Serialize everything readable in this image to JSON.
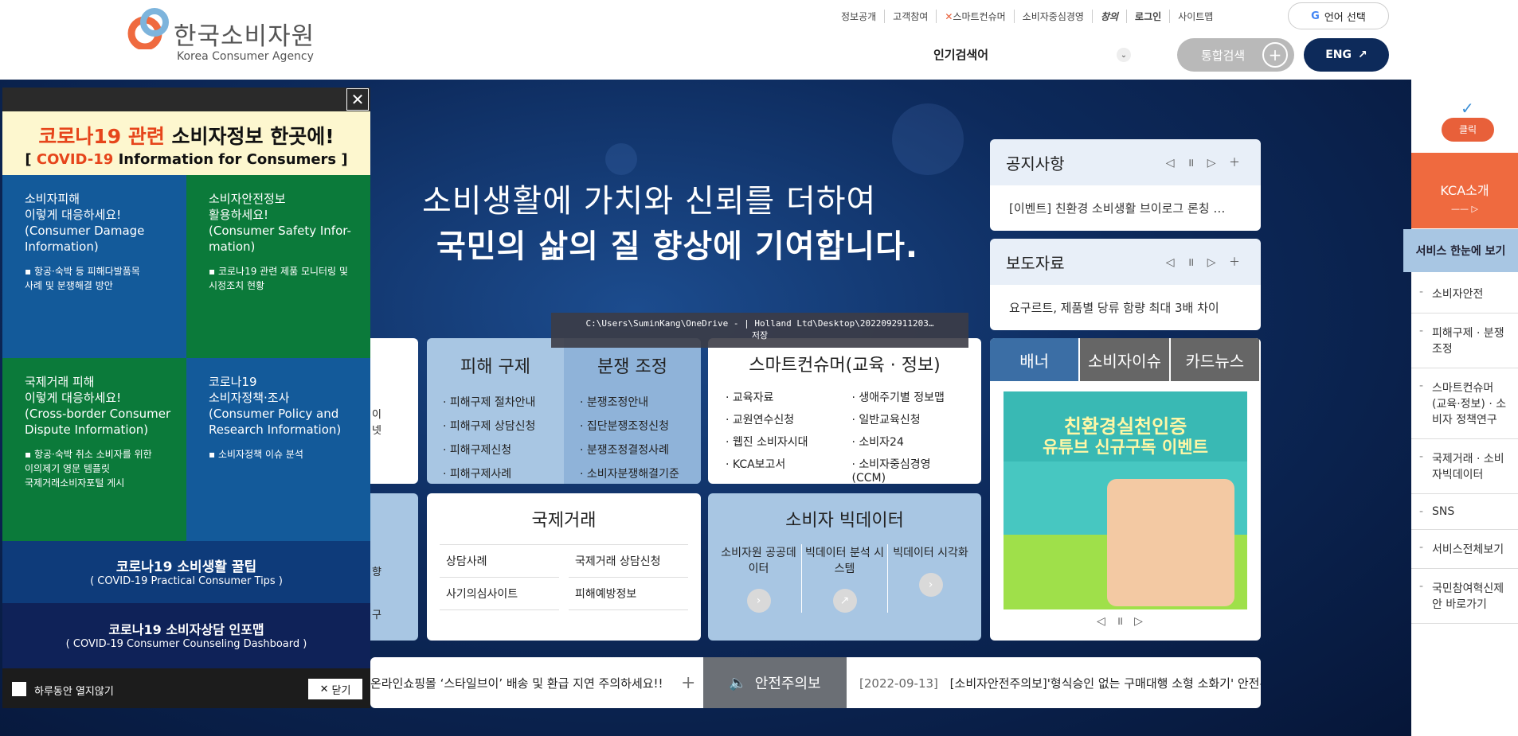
{
  "header": {
    "logo_ko": "한국소비자원",
    "logo_en": "Korea Consumer Agency",
    "util_links": [
      "정보공개",
      "고객참여",
      "스마트컨슈머",
      "소비자중심경영",
      "창의",
      "로그인",
      "사이트맵"
    ],
    "language_label": "언어 선택",
    "popular_label": "인기검색어",
    "search_label": "통합검색",
    "eng_label": "ENG"
  },
  "hero": {
    "line1": "소비생활에 가치와 신뢰를 더하여",
    "line2": "국민의 삶의 질 향상에 기여합니다.",
    "tooltip": "C:\\Users\\SuminKang\\OneDrive - | Holland Ltd\\Desktop\\2022092911203…\n저장"
  },
  "notice": {
    "title": "공지사항",
    "text": "[이벤트] 친환경 소비생활 브이로그 론칭 …"
  },
  "press": {
    "title": "보도자료",
    "text": "요구르트, 제품별 당류 함량 최대 3배 차이"
  },
  "banner_tabs": [
    "배너",
    "소비자이슈",
    "카드뉴스"
  ],
  "banner": {
    "title1": "친환경실천인증",
    "title2": "유튜브 신규구독 이벤트"
  },
  "relief": {
    "title1": "피해 구제",
    "items1": [
      "피해구제 절차안내",
      "피해구제 상담신청",
      "피해구제신청",
      "피해구제사례"
    ],
    "title2": "분쟁 조정",
    "items2": [
      "분쟁조정안내",
      "집단분쟁조정신청",
      "분쟁조정결정사례",
      "소비자분쟁해결기준"
    ]
  },
  "smart": {
    "title": "스마트컨슈머(교육 · 정보)",
    "items": [
      "교육자료",
      "생애주기별 정보맵",
      "교원연수신청",
      "일반교육신청",
      "웹진 소비자시대",
      "소비자24",
      "KCA보고서",
      "소비자중심경영(CCM)"
    ]
  },
  "intl": {
    "title": "국제거래",
    "items": [
      "상담사례",
      "국제거래 상담신청",
      "사기의심사이트",
      "피해예방정보"
    ]
  },
  "bigdata": {
    "title": "소비자 빅데이터",
    "items": [
      "소비자원 공공데이터",
      "빅데이터 분석 시스템",
      "빅데이터 시각화"
    ]
  },
  "left_partial": {
    "a": "이",
    "b": "넷",
    "c": "향",
    "d": "구"
  },
  "bottom": {
    "left_text": "온라인쇼핑몰 ‘스타일브이’ 배송 및 환급 지연 주의하세요!!",
    "warn_label": "안전주의보",
    "date": "[2022-09-13]",
    "right_text": "[소비자안전주의보]'형식승인 없는 구매대행 소형 소화기' 안전주"
  },
  "rightbar": {
    "click": "클릭",
    "kca_intro": "KCA소개",
    "service_view": "서비스 한눈에 보기",
    "items": [
      "소비자안전",
      "피해구제 · 분쟁조정",
      "스마트컨슈머 (교육·정보) · 소비자 정책연구",
      "국제거래 · 소비자빅데이터",
      "SNS",
      "서비스전체보기",
      "국민참여혁신제안 바로가기"
    ]
  },
  "popup": {
    "head1_red": "코로나19 관련",
    "head1_rest": " 소비자정보 한곳에!",
    "head2_pre": "[ ",
    "head2_red": "COVID-19",
    "head2_rest": " Information for Consumers ]",
    "cells": [
      {
        "t": "소비자피해\n이렇게 대응하세요!\n(Consumer Damage\n Information)",
        "s": "▪ 항공·숙박 등 피해다발품목\n  사례 및 분쟁해결 방안"
      },
      {
        "t": "소비자안전정보\n활용하세요!\n(Consumer Safety Infor-\n mation)",
        "s": "▪ 코로나19 관련 제품 모니터링 및\n  시정조치 현황"
      },
      {
        "t": "국제거래 피해\n이렇게 대응하세요!\n(Cross-border Consumer\n Dispute Information)",
        "s": "▪ 항공·숙박 취소 소비자를 위한\n  이의제기 영문 템플릿\n  국제거래소비자포털 게시"
      },
      {
        "t": "코로나19\n소비자정책·조사\n(Consumer Policy and\n Research Information)",
        "s": "▪ 소비자정책 이슈 분석"
      }
    ],
    "tips_a": "코로나19 소비생활 꿀팁",
    "tips_b": "( COVID-19 Practical Consumer Tips )",
    "dash_a": "코로나19 소비자상담 인포맵",
    "dash_b": "( COVID-19 Consumer Counseling Dashboard )",
    "no_show": "하루동안 열지않기",
    "close": "닫기"
  }
}
